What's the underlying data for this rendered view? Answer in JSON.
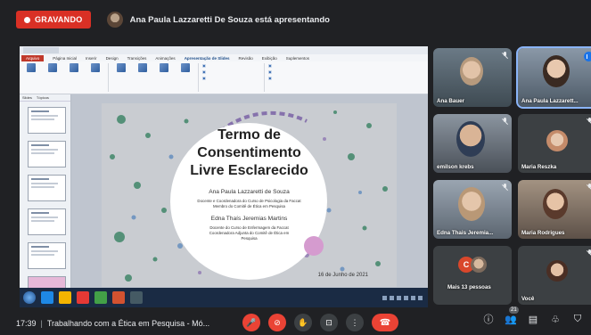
{
  "recording": {
    "label": "GRAVANDO"
  },
  "presenter": {
    "text": "Ana Paula Lazzaretti De Souza está apresentando"
  },
  "ppt": {
    "tabs": [
      "Arquivo",
      "Página Inicial",
      "Inserir",
      "Design",
      "Transições",
      "Animações",
      "Apresentação de Slides",
      "Revisão",
      "Exibição",
      "Suplementos"
    ],
    "active_tab": "Apresentação de Slides",
    "thumb_tabs": [
      "Slides",
      "Tópicos"
    ]
  },
  "slide": {
    "title": [
      "Termo de",
      "Consentimento",
      "Livre Esclarecido"
    ],
    "author1": "Ana Paula Lazzaretti de Souza",
    "author1_desc": [
      "Docente e Coordenadora do Curso de Psicologia da Faccat",
      "Membro do Comitê de Ética em Pesquisa"
    ],
    "author2": "Edna Thaís Jeremias Martins",
    "author2_desc": [
      "Docente do Curso de Enfermagem da Faccat",
      "Coordenadora Adjunta do Comitê de Ética em",
      "Pesquisa"
    ],
    "date": "16 de Junho de 2021"
  },
  "participants": [
    {
      "name": "Ana Bauer",
      "muted": true
    },
    {
      "name": "Ana Paula Lazzarett...",
      "speaking": true
    },
    {
      "name": "emilson krebs",
      "muted": true
    },
    {
      "name": "Maria Reszka",
      "muted": true
    },
    {
      "name": "Edna Thais Jeremia...",
      "muted": true
    },
    {
      "name": "Maria Rodrigues",
      "muted": true
    },
    {
      "name": "Mais 13 pessoas",
      "avatar_letter": "C"
    },
    {
      "name": "Você",
      "muted": true
    }
  ],
  "bottom": {
    "time": "17:39",
    "meeting_title": "Trabalhando com a Ética em Pesquisa - Mó...",
    "participants_count": "21"
  },
  "colors": {
    "record": "#d93025",
    "hangup": "#ea4335",
    "speaking": "#1a73e8"
  }
}
